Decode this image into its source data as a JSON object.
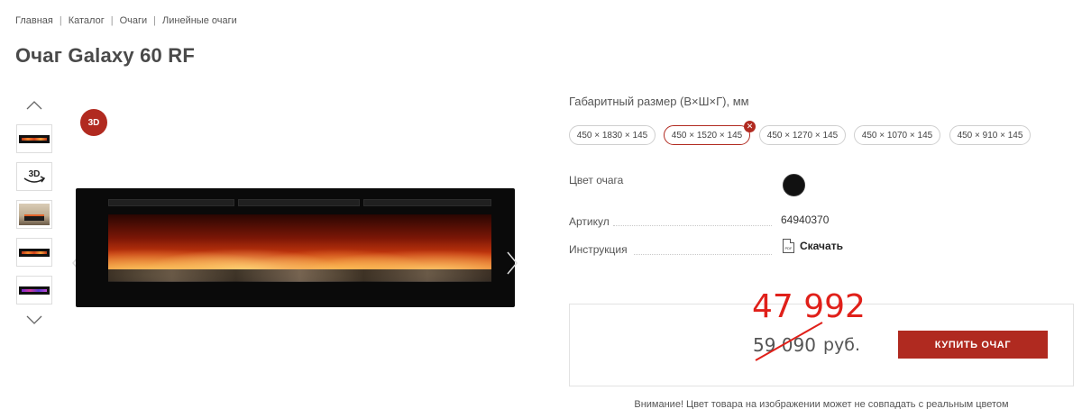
{
  "breadcrumb": [
    "Главная",
    "Каталог",
    "Очаги",
    "Линейные очаги"
  ],
  "title": "Очаг Galaxy 60 RF",
  "badge_3d": "3D",
  "thumbnails": [
    "fire-thumb",
    "3d-view",
    "room-thumb",
    "fire-thumb",
    "fire-thumb-purple"
  ],
  "size": {
    "label": "Габаритный размер (В×Ш×Г), мм",
    "options": [
      "450 × 1830 × 145",
      "450 × 1520 × 145",
      "450 × 1270 × 145",
      "450 × 1070 × 145",
      "450 × 910 × 145"
    ],
    "selected": "450 × 1520 × 145"
  },
  "specs": {
    "color_label": "Цвет очага",
    "color_value": "#111111",
    "article_label": "Артикул",
    "article_value": "64940370",
    "manual_label": "Инструкция",
    "download_label": "Скачать",
    "pdf_text": "PDF"
  },
  "price": {
    "new": "47 992",
    "old": "59 090",
    "currency": "руб.",
    "buy_label": "КУПИТЬ ОЧАГ"
  },
  "notice": "Внимание! Цвет товара на изображении может не совпадать с реальным цветом",
  "colors": {
    "accent": "#b12a20",
    "new_price": "#e0201a"
  }
}
